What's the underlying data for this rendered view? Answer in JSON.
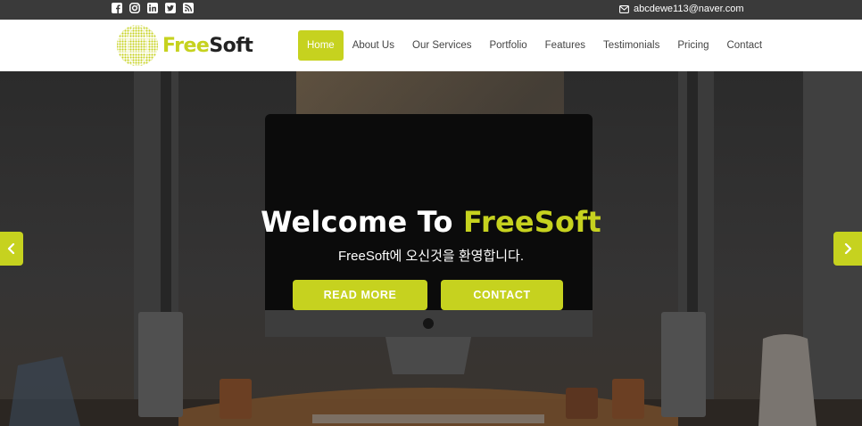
{
  "topbar": {
    "social_icons": [
      "facebook-icon",
      "instagram-icon",
      "linkedin-icon",
      "twitter-icon",
      "rss-icon"
    ],
    "email": "abcdewe113@naver.com",
    "email_icon": "envelope-icon"
  },
  "header": {
    "logo_free": "Free",
    "logo_soft": "Soft",
    "nav": [
      {
        "label": "Home",
        "active": true
      },
      {
        "label": "About Us"
      },
      {
        "label": "Our Services"
      },
      {
        "label": "Portfolio"
      },
      {
        "label": "Features"
      },
      {
        "label": "Testimonials"
      },
      {
        "label": "Pricing"
      },
      {
        "label": "Contact"
      }
    ]
  },
  "hero": {
    "title_prefix": "Welcome To ",
    "title_highlight": "FreeSoft",
    "subtitle": "FreeSoft에 오신것을 환영합니다.",
    "read_more_label": "READ MORE",
    "contact_label": "CONTACT",
    "prev_icon": "chevron-left-icon",
    "next_icon": "chevron-right-icon"
  },
  "colors": {
    "accent": "#c6d21f",
    "topbar_bg": "#3a3a3a",
    "nav_bg": "#ffffff",
    "nav_text": "#444444"
  }
}
